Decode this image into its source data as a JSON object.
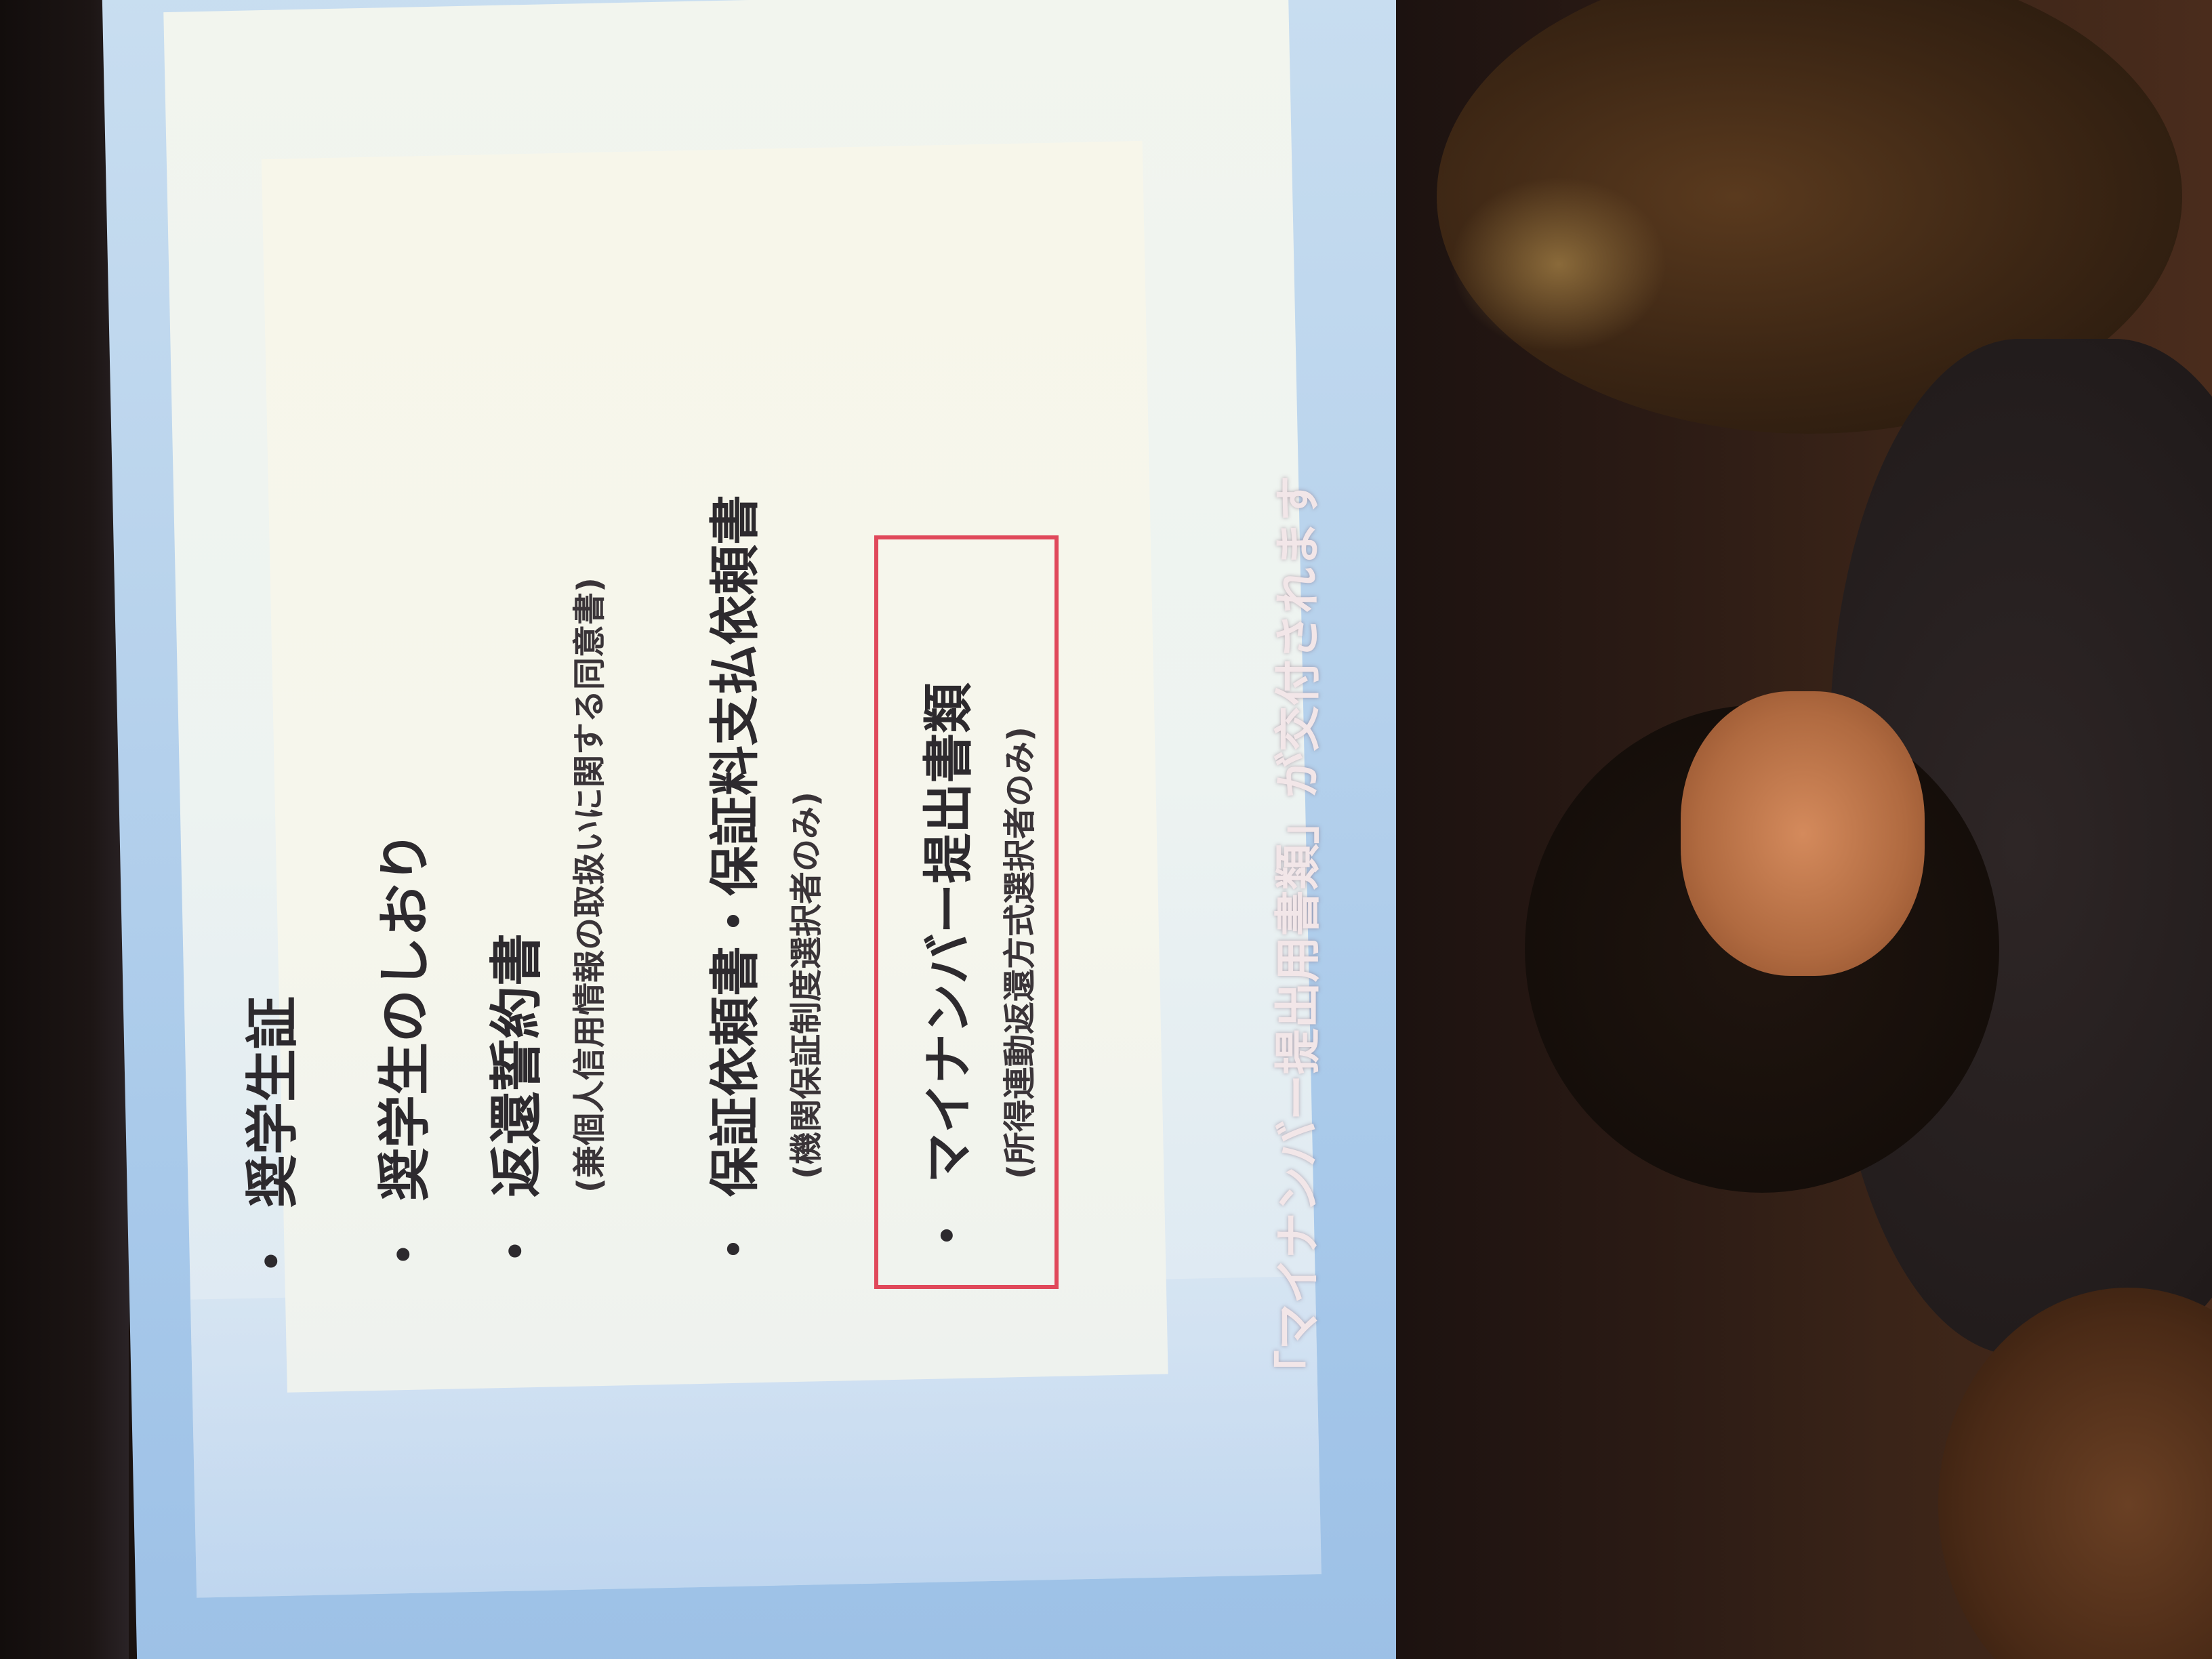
{
  "slide": {
    "items": [
      {
        "bullet": "・",
        "text": "奨学生証"
      },
      {
        "bullet": "・",
        "text": "奨学生のしおり"
      },
      {
        "bullet": "・",
        "text": "返還誓約書",
        "note": "(兼個人信用情報の取扱いに関する同意書)"
      },
      {
        "bullet": "・",
        "text": "保証依頼書・保証料支払依頼書",
        "note": "(機関保証制度選択者のみ)"
      },
      {
        "bullet": "・",
        "text": "マイナンバー提出書類",
        "note": "(所得連動返還方式選択者のみ)"
      }
    ],
    "caption": "「マイナンバー提出用書類」が交付されます",
    "highlight_color": "#e0485a"
  }
}
